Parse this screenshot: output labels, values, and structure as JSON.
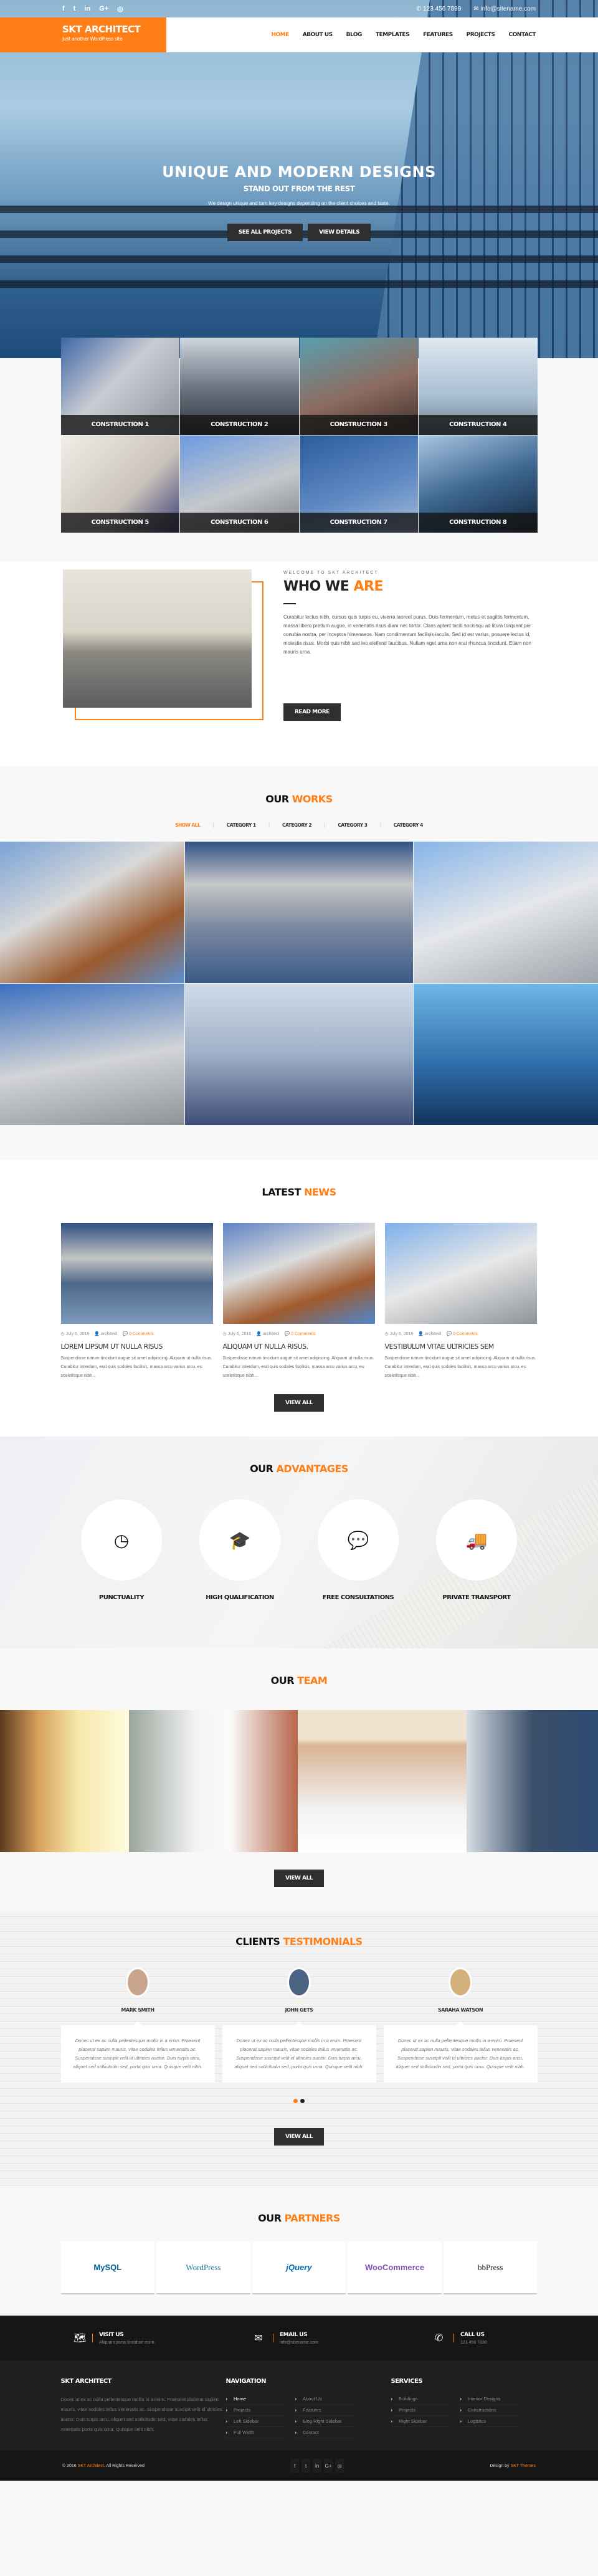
{
  "topbar": {
    "social_icons": [
      "facebook-icon",
      "twitter-icon",
      "linkedin-icon",
      "google-plus-icon",
      "instagram-icon"
    ],
    "social_glyphs": [
      "f",
      "t",
      "in",
      "G+",
      "◎"
    ],
    "phone": "123 456 7899",
    "email": "info@sitename.com"
  },
  "header": {
    "site_title": "SKT ARCHITECT",
    "tagline": "Just another WordPress site",
    "nav": [
      "HOME",
      "ABOUT US",
      "BLOG",
      "TEMPLATES",
      "FEATURES",
      "PROJECTS",
      "CONTACT"
    ],
    "active_nav": "HOME"
  },
  "hero": {
    "title": "UNIQUE AND MODERN DESIGNS",
    "subtitle": "STAND OUT FROM THE REST",
    "text": "We design unique and turn key designs depending on the client choices and taste.",
    "btn_projects": "SEE ALL PROJECTS",
    "btn_details": "VIEW DETAILS"
  },
  "constructions": [
    "CONSTRUCTION 1",
    "CONSTRUCTION 2",
    "CONSTRUCTION 3",
    "CONSTRUCTION 4",
    "CONSTRUCTION 5",
    "CONSTRUCTION 6",
    "CONSTRUCTION 7",
    "CONSTRUCTION 8"
  ],
  "who": {
    "kicker": "WELCOME TO SKT ARCHITECT",
    "title_a": "WHO WE ",
    "title_b": "ARE",
    "body": "Curabitur lectus nibh, cursus quis turpis eu, viverra laoreet purus. Duis fermentum, metus et sagittis fermentum, massa libero pretium augue, in venenatis risus diam nec tortor. Class aptent taciti sociosqu ad litora torquent per conubia nostra, per inceptos himenaeos. Nam condimentum facilisis iaculis. Sed id est varius, posuere lectus id, molestie risus. Morbi quis nibh sed leo eleifend faucibus. Nullam eget urna non erat rhoncus tincidunt. Etiam non mauris urna.",
    "button": "READ MORE"
  },
  "works": {
    "title_a": "OUR ",
    "title_b": "WORKS",
    "filters": [
      "SHOW ALL",
      "CATEGORY 1",
      "CATEGORY 2",
      "CATEGORY 3",
      "CATEGORY 4"
    ],
    "active_filter": "SHOW ALL"
  },
  "news": {
    "title_a": "LATEST ",
    "title_b": "NEWS",
    "posts": [
      {
        "date": "July 6, 2016",
        "author": "architect",
        "comments": "0 Comments",
        "title": "LOREM LIPSUM UT NULLA RISUS",
        "excerpt": "Suspendisse rutrum tincidunt augue sit amet adipiscing. Aliquam ut nulla risus. Curabitur interdum, erat quis sodales facilisis, massa arcu varius arcu, eu scelerisque nibh..."
      },
      {
        "date": "July 6, 2016",
        "author": "architect",
        "comments": "0 Comments",
        "title": "ALIQUAM UT NULLA RISUS.",
        "excerpt": "Suspendisse rutrum tincidunt augue sit amet adipiscing. Aliquam ut nulla risus. Curabitur interdum, erat quis sodales facilisis, massa arcu varius arcu, eu scelerisque nibh..."
      },
      {
        "date": "July 6, 2016",
        "author": "architect",
        "comments": "0 Comments",
        "title": "VESTIBULUM VITAE ULTRICIES SEM",
        "excerpt": "Suspendisse rutrum tincidunt augue sit amet adipiscing. Aliquam ut nulla risus. Curabitur interdum, erat quis sodales facilisis, massa arcu varius arcu, eu scelerisque nibh..."
      }
    ],
    "button": "VIEW ALL"
  },
  "advantages": {
    "title_a": "OUR ",
    "title_b": "ADVANTAGES",
    "items": [
      {
        "icon": "clock-icon",
        "glyph": "◷",
        "label": "PUNCTUALITY"
      },
      {
        "icon": "graduation-cap-icon",
        "glyph": "🎓",
        "label": "HIGH QUALIFICATION"
      },
      {
        "icon": "chat-bubbles-icon",
        "glyph": "💬",
        "label": "FREE CONSULTATIONS"
      },
      {
        "icon": "truck-icon",
        "glyph": "🚚",
        "label": "PRIVATE TRANSPORT"
      }
    ]
  },
  "team": {
    "title_a": "OUR ",
    "title_b": "TEAM",
    "button": "VIEW ALL"
  },
  "testimonials": {
    "title_a": "CLIENTS ",
    "title_b": "TESTIMONIALS",
    "items": [
      {
        "name": "MARK SMITH",
        "text": "Donec ut ex ac nulla pellentesque mollis in a enim. Praesent placerat sapien mauris, vitae sodales tellus venenatis ac. Suspendisse suscipit velit id ultricies auctor. Duis turpis arcu, aliquet sed sollicitudin sed, porta quis urna. Quisque velit nibh."
      },
      {
        "name": "JOHN GETS",
        "text": "Donec ut ex ac nulla pellentesque mollis in a enim. Praesent placerat sapien mauris, vitae sodales tellus venenatis ac. Suspendisse suscipit velit id ultricies auctor. Duis turpis arcu, aliquet sed sollicitudin sed, porta quis urna. Quisque velit nibh."
      },
      {
        "name": "SARAHA WATSON",
        "text": "Donec ut ex ac nulla pellentesque mollis in a enim. Praesent placerat sapien mauris, vitae sodales tellus venenatis ac. Suspendisse suscipit velit id ultricies auctor. Duis turpis arcu, aliquet sed sollicitudin sed, porta quis urna. Quisque velit nibh."
      }
    ],
    "active_slide": 1,
    "slide_count": 2,
    "button": "VIEW ALL"
  },
  "partners": {
    "title_a": "OUR ",
    "title_b": "PARTNERS",
    "logos": [
      "MySQL",
      "WordPress",
      "jQuery",
      "WooCommerce",
      "bbPress"
    ]
  },
  "footer": {
    "contact": [
      {
        "icon": "map-icon",
        "glyph": "🗺",
        "title": "VISIT US",
        "value": "Aliquam porta tincidunt enim."
      },
      {
        "icon": "envelope-icon",
        "glyph": "✉",
        "title": "EMAIL US",
        "value": "info@sitename.com"
      },
      {
        "icon": "phone-icon",
        "glyph": "✆",
        "title": "CALL US",
        "value": "123 456 7890"
      }
    ],
    "about_title": "SKT ARCHITECT",
    "about_text": "Donec ut ex ac nulla pellentesque mollis in a enim. Praesent placerat sapien mauris, vitae sodales tellus venenatis ac. Suspendisse suscipit velit id ultricies auctor. Duis turpis arcu, aliquet sed sollicitudin sed, vitae sodales tellus venenatis porta quis urna. Quisque velit nibh.",
    "nav_title": "NAVIGATION",
    "nav_col1": [
      "Home",
      "Projects",
      "Left Sidebar",
      "Full Width"
    ],
    "nav_col2": [
      "About Us",
      "Features",
      "Blog Right Sidebar",
      "Contact"
    ],
    "services_title": "SERVICES",
    "services_col1": [
      "Buildings",
      "Projects",
      "Right Sidebar"
    ],
    "services_col2": [
      "Interior Designs",
      "Constructions",
      "Logistics"
    ],
    "copyright_pre": "© 2016 ",
    "copyright_link": "SKT Architect",
    "copyright_post": ". All Rights Reserved",
    "design_pre": "Design by ",
    "design_link": "SKT Themes"
  },
  "colors": {
    "accent": "#ff7f16",
    "dark": "#1f1f1f"
  }
}
